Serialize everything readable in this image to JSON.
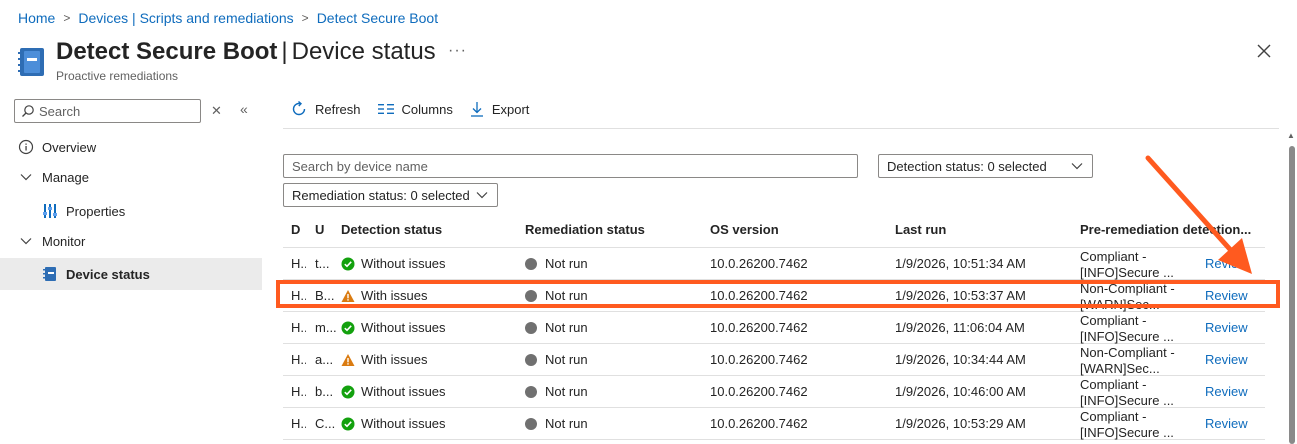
{
  "breadcrumb": {
    "items": [
      "Home",
      "Devices | Scripts and remediations",
      "Detect Secure Boot"
    ],
    "separator": ">"
  },
  "header": {
    "title_bold": "Detect Secure Boot",
    "title_divider": "|",
    "title_rest": "Device status",
    "subtitle": "Proactive remediations",
    "more_label": "···",
    "close_icon": "close-icon"
  },
  "sidebar": {
    "search_placeholder": "Search",
    "clear_label": "✕",
    "collapse_label": "«",
    "items": [
      {
        "label": "Overview",
        "icon": "info-icon"
      },
      {
        "label": "Manage",
        "icon": "chevron-down-icon"
      },
      {
        "label": "Properties",
        "icon": "properties-icon"
      },
      {
        "label": "Monitor",
        "icon": "chevron-down-icon"
      },
      {
        "label": "Device status",
        "icon": "device-status-icon"
      }
    ]
  },
  "toolbar": {
    "refresh_label": "Refresh",
    "columns_label": "Columns",
    "export_label": "Export"
  },
  "filters": {
    "search_placeholder": "Search by device name",
    "detection_label": "Detection status: 0 selected",
    "remediation_label": "Remediation status: 0 selected"
  },
  "table": {
    "headers": [
      "D",
      "U",
      "Detection status",
      "Remediation status",
      "OS version",
      "Last run",
      "Pre-remediation detection..."
    ],
    "rows": [
      {
        "device": "H..",
        "user": "t...",
        "detection": "Without issues",
        "detection_type": "ok",
        "remediation": "Not run",
        "os": "10.0.26200.7462",
        "last_run": "1/9/2026, 10:51:34 AM",
        "pre_line1": "Compliant -",
        "pre_line2": "[INFO]Secure ...",
        "action": "Review"
      },
      {
        "device": "H..",
        "user": "B...",
        "detection": "With issues",
        "detection_type": "warn",
        "remediation": "Not run",
        "os": "10.0.26200.7462",
        "last_run": "1/9/2026, 10:53:37 AM",
        "pre_line1": "Non-Compliant -",
        "pre_line2": "[WARN]Sec...",
        "action": "Review"
      },
      {
        "device": "H..",
        "user": "m...",
        "detection": "Without issues",
        "detection_type": "ok",
        "remediation": "Not run",
        "os": "10.0.26200.7462",
        "last_run": "1/9/2026, 11:06:04 AM",
        "pre_line1": "Compliant -",
        "pre_line2": "[INFO]Secure ...",
        "action": "Review"
      },
      {
        "device": "H..",
        "user": "a...",
        "detection": "With issues",
        "detection_type": "warn",
        "remediation": "Not run",
        "os": "10.0.26200.7462",
        "last_run": "1/9/2026, 10:34:44 AM",
        "pre_line1": "Non-Compliant -",
        "pre_line2": "[WARN]Sec...",
        "action": "Review"
      },
      {
        "device": "H..",
        "user": "b...",
        "detection": "Without issues",
        "detection_type": "ok",
        "remediation": "Not run",
        "os": "10.0.26200.7462",
        "last_run": "1/9/2026, 10:46:00 AM",
        "pre_line1": "Compliant -",
        "pre_line2": "[INFO]Secure ...",
        "action": "Review"
      },
      {
        "device": "H..",
        "user": "C...",
        "detection": "Without issues",
        "detection_type": "ok",
        "remediation": "Not run",
        "os": "10.0.26200.7462",
        "last_run": "1/9/2026, 10:53:29 AM",
        "pre_line1": "Compliant -",
        "pre_line2": "[INFO]Secure ...",
        "action": "Review"
      }
    ]
  },
  "colors": {
    "accent": "#0f6cbd",
    "ok": "#13a10e",
    "warn": "#da7b11",
    "not_run": "#707070",
    "annotation": "#ff5a1f"
  }
}
